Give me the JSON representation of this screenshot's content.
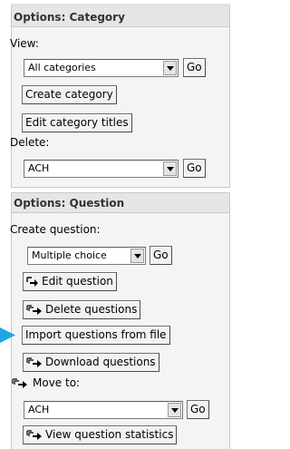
{
  "category_panel": {
    "title": "Options: Category",
    "view_label": "View:",
    "view_select": "All categories",
    "view_go": "Go",
    "create_button": "Create category",
    "edit_titles_button": "Edit category titles",
    "delete_label": "Delete:",
    "delete_select": "ACH",
    "delete_go": "Go"
  },
  "question_panel": {
    "title": "Options: Question",
    "create_label": "Create question:",
    "create_select": "Multiple choice",
    "create_go": "Go",
    "edit_button": "Edit question",
    "delete_button": "Delete questions",
    "import_button": "Import questions from file",
    "download_button": "Download questions",
    "move_label": "Move to:",
    "move_select": "ACH",
    "move_go": "Go",
    "stats_button": "View question statistics"
  },
  "colors": {
    "pointer": "#1ea6e6",
    "panel_bg": "#f4f4f4",
    "header_bg": "#e6e6e6"
  },
  "icons": {
    "select_arrow": "chevron-down-icon",
    "question_action": "arrow-select-icon",
    "pointer": "triangle-pointer-icon"
  }
}
